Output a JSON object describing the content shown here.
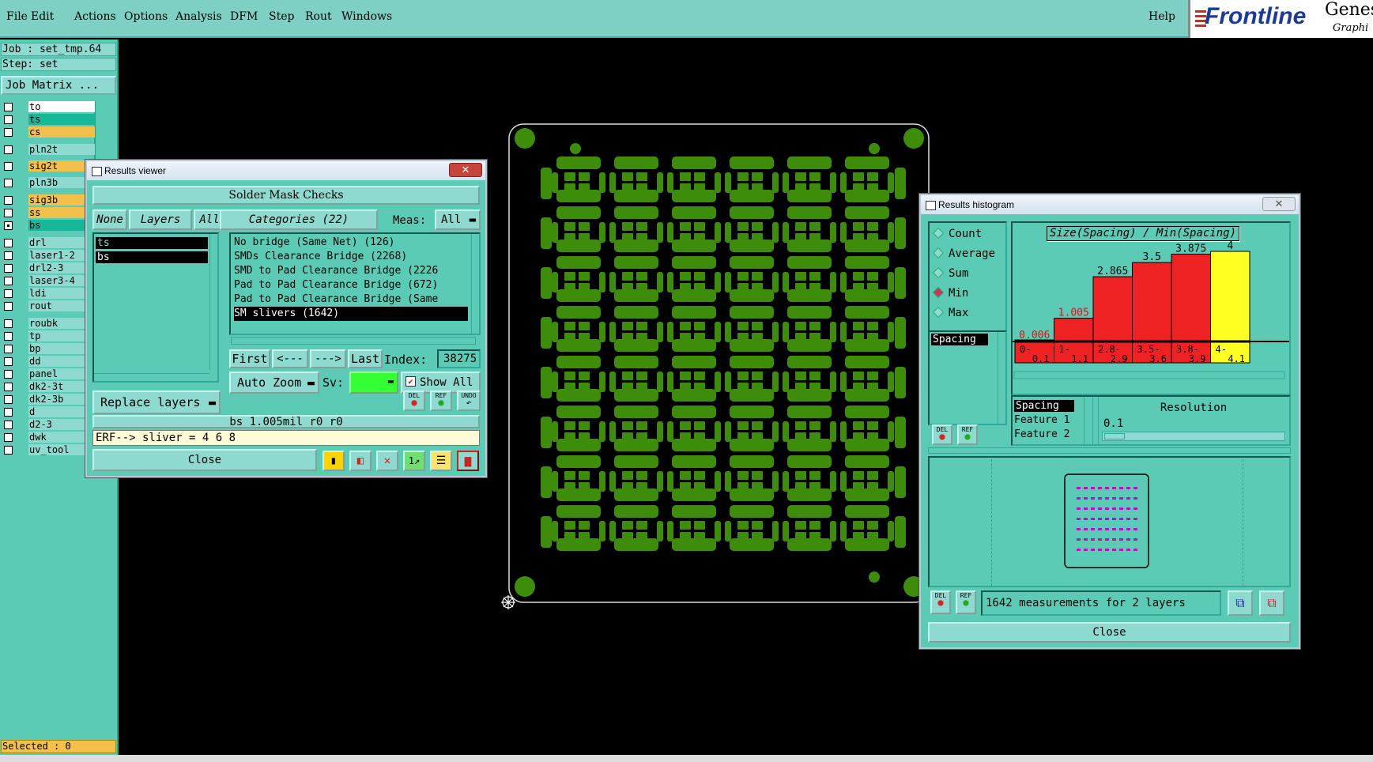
{
  "menu": [
    "File",
    "Edit",
    "Actions",
    "Options",
    "Analysis",
    "DFM",
    "Step",
    "Rout",
    "Windows"
  ],
  "help": "Help",
  "logo": {
    "brand": "Frontline",
    "g1": "Genes",
    "g2": "Graphi"
  },
  "left": {
    "job": "Job : set_tmp.64",
    "step": "Step: set",
    "job_matrix": "Job Matrix ...",
    "layers": [
      {
        "name": "to",
        "color": "#ffffff",
        "checked": false
      },
      {
        "name": "ts",
        "color": "#17b89a",
        "checked": false
      },
      {
        "name": "cs",
        "color": "#f4c04c",
        "checked": false
      },
      {
        "name": "pln2t",
        "color": "#8fdad0",
        "checked": false
      },
      {
        "name": "sig2t",
        "color": "#f4c04c",
        "checked": false
      },
      {
        "name": "pln3b",
        "color": "#8fdad0",
        "checked": false
      },
      {
        "name": "sig3b",
        "color": "#f4c04c",
        "checked": false
      },
      {
        "name": "ss",
        "color": "#f4c04c",
        "checked": false
      },
      {
        "name": "bs",
        "color": "#17b89a",
        "checked": true
      },
      {
        "name": "drl",
        "color": "#8fdad0",
        "checked": false
      },
      {
        "name": "laser1-2",
        "color": "#8fdad0",
        "checked": false
      },
      {
        "name": "drl2-3",
        "color": "#8fdad0",
        "checked": false
      },
      {
        "name": "laser3-4",
        "color": "#8fdad0",
        "checked": false
      },
      {
        "name": "ldi",
        "color": "#8fdad0",
        "checked": false
      },
      {
        "name": "rout",
        "color": "#8fdad0",
        "checked": false
      },
      {
        "name": "roubk",
        "color": "#8fdad0",
        "checked": false
      },
      {
        "name": "tp",
        "color": "#8fdad0",
        "checked": false
      },
      {
        "name": "bp",
        "color": "#8fdad0",
        "checked": false
      },
      {
        "name": "dd",
        "color": "#8fdad0",
        "checked": false
      },
      {
        "name": "panel",
        "color": "#8fdad0",
        "checked": false
      },
      {
        "name": "dk2-3t",
        "color": "#8fdad0",
        "checked": false
      },
      {
        "name": "dk2-3b",
        "color": "#8fdad0",
        "checked": false
      },
      {
        "name": "d",
        "color": "#8fdad0",
        "checked": false
      },
      {
        "name": "d2-3",
        "color": "#8fdad0",
        "checked": false
      },
      {
        "name": "dwk",
        "color": "#8fdad0",
        "checked": false
      },
      {
        "name": "uv_tool",
        "color": "#8fdad0",
        "checked": false
      }
    ],
    "selected": "Selected : 0"
  },
  "rv": {
    "title": "Results viewer",
    "header": "Solder Mask Checks",
    "none": "None",
    "layers": "Layers",
    "all": "All",
    "categories": "Categories (22)",
    "meas_label": "Meas:",
    "meas_value": "All",
    "layer_items": [
      "ts",
      "bs"
    ],
    "cat_items": [
      "No bridge (Same Net) (126)",
      "SMDs Clearance Bridge (2268)",
      "SMD to Pad Clearance Bridge (2226",
      "Pad to Pad Clearance Bridge (672)",
      "Pad to Pad Clearance Bridge (Same",
      "SM slivers (1642)"
    ],
    "first": "First",
    "prev": "<---",
    "next": "--->",
    "last": "Last",
    "index_label": "Index:",
    "index_value": "38275",
    "auto_zoom": "Auto Zoom",
    "sv_label": "Sv:",
    "show_all": "Show All",
    "replace_layers": "Replace layers",
    "status": "bs 1.005mil  r0  r0",
    "erf": "ERF--> sliver = 4 6 8",
    "close": "Close",
    "icons": [
      "DEL",
      "REF",
      "UNDO"
    ]
  },
  "rh": {
    "title": "Results histogram",
    "modes": [
      {
        "label": "Count",
        "on": false
      },
      {
        "label": "Average",
        "on": false
      },
      {
        "label": "Sum",
        "on": false
      },
      {
        "label": "Min",
        "on": true
      },
      {
        "label": "Max",
        "on": false
      }
    ],
    "attr": "Spacing",
    "chart_title": "Size(Spacing) / Min(Spacing)",
    "axis_items": [
      "Spacing",
      "Feature 1",
      "Feature 2"
    ],
    "resolution_label": "Resolution",
    "resolution_value": "0.1",
    "measurements": "1642 measurements for 2 layers",
    "close": "Close",
    "icons": [
      "DEL",
      "REF"
    ]
  },
  "chart_data": {
    "type": "bar",
    "title": "Size(Spacing) / Min(Spacing)",
    "categories": [
      [
        "0-",
        "0.1"
      ],
      [
        "1-",
        "1.1"
      ],
      [
        "2.8-",
        "2.9"
      ],
      [
        "3.5-",
        "3.6"
      ],
      [
        "3.8-",
        "3.9"
      ],
      [
        "4-",
        "4.1"
      ]
    ],
    "values": [
      0.006,
      1.005,
      2.865,
      3.5,
      3.875,
      4
    ],
    "value_labels": [
      "0.006",
      "1.005",
      "2.865",
      "3.5",
      "3.875",
      "4"
    ],
    "colors": [
      "#ee2222",
      "#ee2222",
      "#ee2222",
      "#ee2222",
      "#ee2222",
      "#ffff22"
    ],
    "ylim": [
      0,
      4
    ]
  }
}
